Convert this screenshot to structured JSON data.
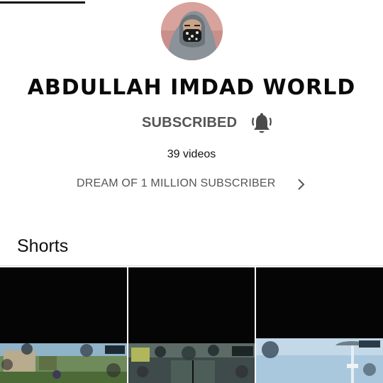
{
  "channel": {
    "name": "ABDULLAH IMDAD WORLD",
    "subscribe_label": "SUBSCRIBED",
    "video_count": "39 videos",
    "description": "DREAM OF 1 MILLION SUBSCRIBER"
  },
  "shorts": {
    "title": "Shorts",
    "items": [
      {
        "scene": "gameplay-village"
      },
      {
        "scene": "gameplay-scope"
      },
      {
        "scene": "gameplay-sky"
      }
    ]
  },
  "colors": {
    "accent_text": "#555555",
    "thumbnail_bg": "#050505"
  },
  "icons": {
    "notification": "bell-icon",
    "expand": "chevron-right-icon"
  }
}
